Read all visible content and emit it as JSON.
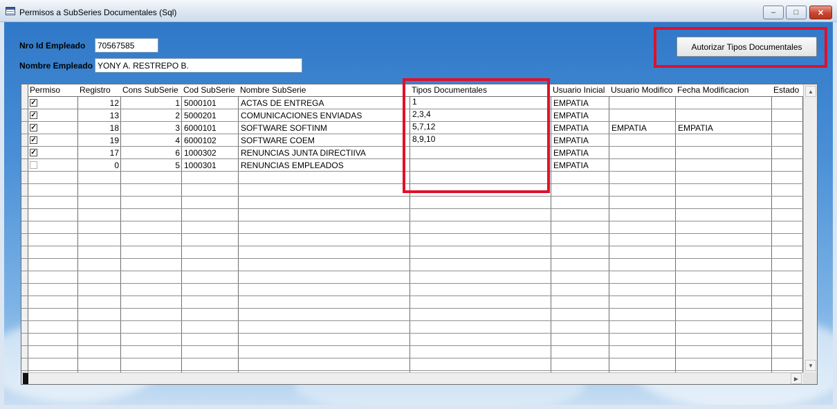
{
  "window": {
    "title": "Permisos a SubSeries Documentales (Sql)",
    "min_glyph": "–",
    "max_glyph": "□",
    "close_glyph": "✕"
  },
  "form": {
    "id_label": "Nro Id Empleado",
    "id_value": "70567585",
    "name_label": "Nombre Empleado",
    "name_value": "YONY A. RESTREPO B."
  },
  "authorize_button": "Autorizar Tipos Documentales",
  "table": {
    "columns": [
      "Permiso",
      "Registro",
      "Cons SubSerie",
      "Cod SubSerie",
      "Nombre SubSerie",
      "Tipos Documentales",
      "Usuario Inicial",
      "Usuario Modifico",
      "Fecha Modificacion",
      "Estado"
    ],
    "rows": [
      {
        "permiso": true,
        "registro": "12",
        "cons": "1",
        "cod": "5000101",
        "nombre": "ACTAS DE ENTREGA",
        "tipos": "1",
        "usuario_inicial": "EMPATIA",
        "usuario_modifico": "",
        "fecha": ""
      },
      {
        "permiso": true,
        "registro": "13",
        "cons": "2",
        "cod": "5000201",
        "nombre": "COMUNICACIONES ENVIADAS",
        "tipos": "2,3,4",
        "usuario_inicial": "EMPATIA",
        "usuario_modifico": "",
        "fecha": ""
      },
      {
        "permiso": true,
        "registro": "18",
        "cons": "3",
        "cod": "6000101",
        "nombre": "SOFTWARE SOFTINM",
        "tipos": "5,7,12",
        "usuario_inicial": "EMPATIA",
        "usuario_modifico": "EMPATIA",
        "fecha": "EMPATIA"
      },
      {
        "permiso": true,
        "registro": "19",
        "cons": "4",
        "cod": "6000102",
        "nombre": "SOFTWARE COEM",
        "tipos": "8,9,10",
        "usuario_inicial": "EMPATIA",
        "usuario_modifico": "",
        "fecha": ""
      },
      {
        "permiso": true,
        "registro": "17",
        "cons": "6",
        "cod": "1000302",
        "nombre": "RENUNCIAS JUNTA DIRECTIIVA",
        "tipos": "",
        "usuario_inicial": "EMPATIA",
        "usuario_modifico": "",
        "fecha": ""
      },
      {
        "permiso": false,
        "registro": "0",
        "cons": "5",
        "cod": "1000301",
        "nombre": "RENUNCIAS EMPLEADOS",
        "tipos": "",
        "usuario_inicial": "EMPATIA",
        "usuario_modifico": "",
        "fecha": ""
      }
    ]
  },
  "icons": [
    "table-icon",
    "minimize-icon",
    "maximize-icon",
    "close-icon",
    "scroll-up-icon",
    "scroll-down-icon",
    "scroll-left-icon",
    "scroll-right-icon",
    "checkbox-icon"
  ],
  "colors": {
    "highlight": "#e0102a",
    "title_bar": "#dbe5f1",
    "client_bg": "#3b82cf"
  }
}
